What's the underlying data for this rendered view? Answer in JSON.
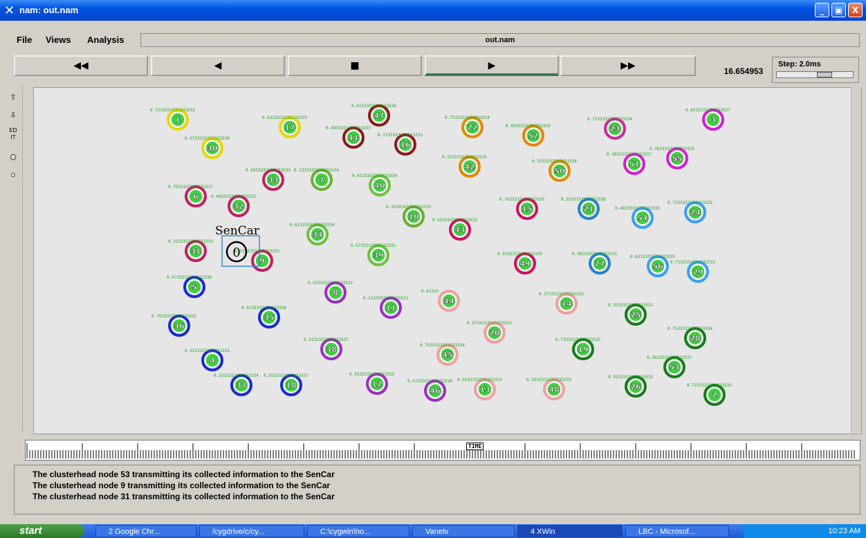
{
  "window": {
    "title": "nam: out.nam",
    "minimize": "_",
    "maximize": "▣",
    "close": "X"
  },
  "menu": {
    "file": "File",
    "views": "Views",
    "analysis": "Analysis",
    "filename": "out.nam"
  },
  "controls": {
    "rewind": "◀◀",
    "back": "◀",
    "stop": "■",
    "play": "▶",
    "ffwd": "▶▶",
    "time": "16.654953",
    "step": "Step: 2.0ms"
  },
  "tools": {
    "zoom_in": "⇧",
    "zoom_out": "⇩",
    "edit": "ED IT"
  },
  "sencar": {
    "label": "SenCar",
    "node": "0"
  },
  "nodes": [
    {
      "id": "1",
      "color": "#e6d800",
      "value": "0.7233333333333332"
    },
    {
      "id": "47",
      "color": "#8b1a1a",
      "value": "0.6133333333333334"
    },
    {
      "id": "17",
      "color": "#e6d800",
      "value": "0.6233333333333335"
    },
    {
      "id": "22",
      "color": "#e08a00",
      "value": "0.7533333333333334"
    },
    {
      "id": "52",
      "color": "#e08a00",
      "value": "0.4933333333333335"
    },
    {
      "id": "23",
      "color": "#cc2a9a",
      "value": "0.7533333333333334"
    },
    {
      "id": "3",
      "color": "#d020d0",
      "value": "0.6533333333333337"
    },
    {
      "id": "41",
      "color": "#8b1a1a",
      "value": "0.4933333333333333"
    },
    {
      "id": "16",
      "color": "#8b1a1a",
      "value": "0.7233333333333332"
    },
    {
      "id": "30",
      "color": "#e6d800",
      "value": "0.6733333333333336"
    },
    {
      "id": "42",
      "color": "#e08a00",
      "value": "0.3333333333333335"
    },
    {
      "id": "50",
      "color": "#e08a00",
      "value": "0.3333333333333336"
    },
    {
      "id": "51",
      "color": "#d020d0",
      "value": "0.3033333333333337"
    },
    {
      "id": "55",
      "color": "#d020d0",
      "value": "0.7633333333333335"
    },
    {
      "id": "33",
      "color": "#c02060",
      "value": "0.5033333333333333"
    },
    {
      "id": "7",
      "color": "#6ab030",
      "value": "0.3333333333333334"
    },
    {
      "id": "40",
      "color": "#70c040",
      "value": "0.6133333333333334"
    },
    {
      "id": "6",
      "color": "#c02060",
      "value": "0.7033333333333337"
    },
    {
      "id": "32",
      "color": "#c02060",
      "value": "0.4833333333333335"
    },
    {
      "id": "15",
      "color": "#d01060",
      "value": "0.7633333333333335"
    },
    {
      "id": "21",
      "color": "#2a80d0",
      "value": "0.3333333333333336"
    },
    {
      "id": "54",
      "color": "#3aa0f0",
      "value": "0.4833333333333335"
    },
    {
      "id": "24",
      "color": "#3aa0f0",
      "value": "0.7233333333333332"
    },
    {
      "id": "10",
      "color": "#6ab030",
      "value": "0.3533333333333333"
    },
    {
      "id": "43",
      "color": "#d01060",
      "value": "0.5533333333333333"
    },
    {
      "id": "34",
      "color": "#70c040",
      "value": "0.6133333333333334"
    },
    {
      "id": "31",
      "color": "#c02060",
      "value": "0.3333333333333333"
    },
    {
      "id": "9",
      "color": "#c02060",
      "value": "0.3333333333333333"
    },
    {
      "id": "39",
      "color": "#70c040",
      "value": "0.5733333333333331"
    },
    {
      "id": "49",
      "color": "#d01060",
      "value": "0.3333333333333335"
    },
    {
      "id": "27",
      "color": "#2a80d0",
      "value": "0.3633333333333333"
    },
    {
      "id": "56",
      "color": "#3aa0f0",
      "value": "0.6233333333333335"
    },
    {
      "id": "29",
      "color": "#3aa0f0",
      "value": "0.7133333333333331"
    },
    {
      "id": "5",
      "color": "#1a2ad0",
      "value": "0.6733333333333336"
    },
    {
      "id": "8",
      "color": "#9a30c0",
      "value": "0.5333333333333332"
    },
    {
      "id": "11",
      "color": "#9a30c0",
      "value": "0.5333333333333331"
    },
    {
      "id": "44",
      "color": "#f0a0a0",
      "value": "0.63333"
    },
    {
      "id": "14",
      "color": "#f0a0a0",
      "value": "0.3733333333333332"
    },
    {
      "id": "25",
      "color": "#1a7a1a",
      "value": "0.3533333333333332"
    },
    {
      "id": "36",
      "color": "#1a2ad0",
      "value": "0.7033333333333333"
    },
    {
      "id": "35",
      "color": "#1a2ad0",
      "value": "0.5133333333333336"
    },
    {
      "id": "20",
      "color": "#f0a0a0",
      "value": "0.5733333333333331"
    },
    {
      "id": "28",
      "color": "#1a7a1a",
      "value": "0.7533333333333334"
    },
    {
      "id": "38",
      "color": "#9a30c0",
      "value": "0.3133333333333337"
    },
    {
      "id": "45",
      "color": "#f0a0a0",
      "value": "0.7533333333333334"
    },
    {
      "id": "19",
      "color": "#1a7a1a",
      "value": "0.7333333333333333"
    },
    {
      "id": "4",
      "color": "#1a2ad0",
      "value": "0.3533333333333333"
    },
    {
      "id": "53",
      "color": "#1a7a1a",
      "value": "0.3033333333333337"
    },
    {
      "id": "37",
      "color": "#1a2ad0",
      "value": "0.3333333333333334"
    },
    {
      "id": "18",
      "color": "#1a2ad0",
      "value": "0.5533333333333337"
    },
    {
      "id": "12",
      "color": "#9a30c0",
      "value": "0.3533333333333333"
    },
    {
      "id": "46",
      "color": "#9a30c0",
      "value": "0.5733333333333334"
    },
    {
      "id": "13",
      "color": "#f0a0a0",
      "value": "0.5533333333333333"
    },
    {
      "id": "48",
      "color": "#f0a0a0",
      "value": "0.3333333333333333"
    },
    {
      "id": "26",
      "color": "#1a7a1a",
      "value": "0.5533333333333335"
    },
    {
      "id": "2",
      "color": "#1a7a1a",
      "value": "0.7233333333333332"
    }
  ],
  "timeline_label": "TIME",
  "messages": [
    "The clusterhead node 53 transmitting its collected information to the SenCar",
    "The clusterhead node 9 transmitting its collected information to the SenCar",
    "The clusterhead node 31 transmitting its collected information to the SenCar"
  ],
  "taskbar": {
    "start": "start",
    "tasks": [
      "2 Google Chr...",
      "/cygdrive/c/cy...",
      "C:\\cygwin\\ho...",
      "Vanetv",
      "4 XWin",
      "LBC - Microsof..."
    ],
    "clock": "10:23 AM"
  }
}
